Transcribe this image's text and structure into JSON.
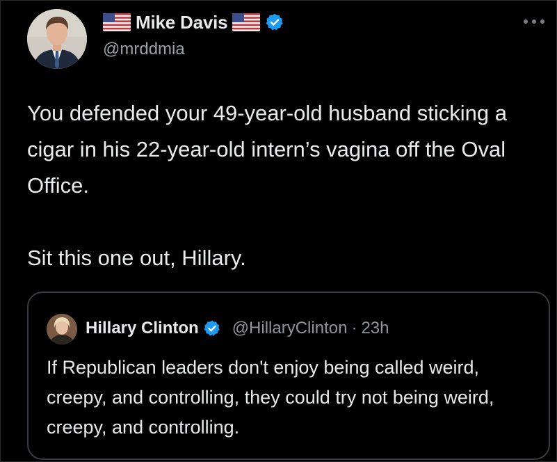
{
  "author": {
    "display_name": "Mike Davis",
    "handle": "@mrddmia",
    "verified": true,
    "name_emoji": "us-flag-icon"
  },
  "tweet": {
    "paragraph_1": "You defended your 49-year-old husband sticking a cigar in his 22-year-old intern’s vagina off the Oval Office.",
    "paragraph_2": "Sit this one out, Hillary."
  },
  "quoted_tweet": {
    "display_name": "Hillary Clinton",
    "handle": "@HillaryClinton",
    "separator": "·",
    "time": "23h",
    "verified": true,
    "text": "If Republican leaders don't enjoy being called weird, creepy, and controlling, they could try not being weird, creepy, and controlling."
  },
  "icons": {
    "more": "more-options-icon",
    "verified": "verified-badge-icon",
    "flag": "us-flag-icon"
  },
  "colors": {
    "background": "#000000",
    "text_primary": "#e7e9ea",
    "text_secondary": "#9aa0a6",
    "verified_blue": "#1d9bf0",
    "card_border": "#3a3d41"
  }
}
